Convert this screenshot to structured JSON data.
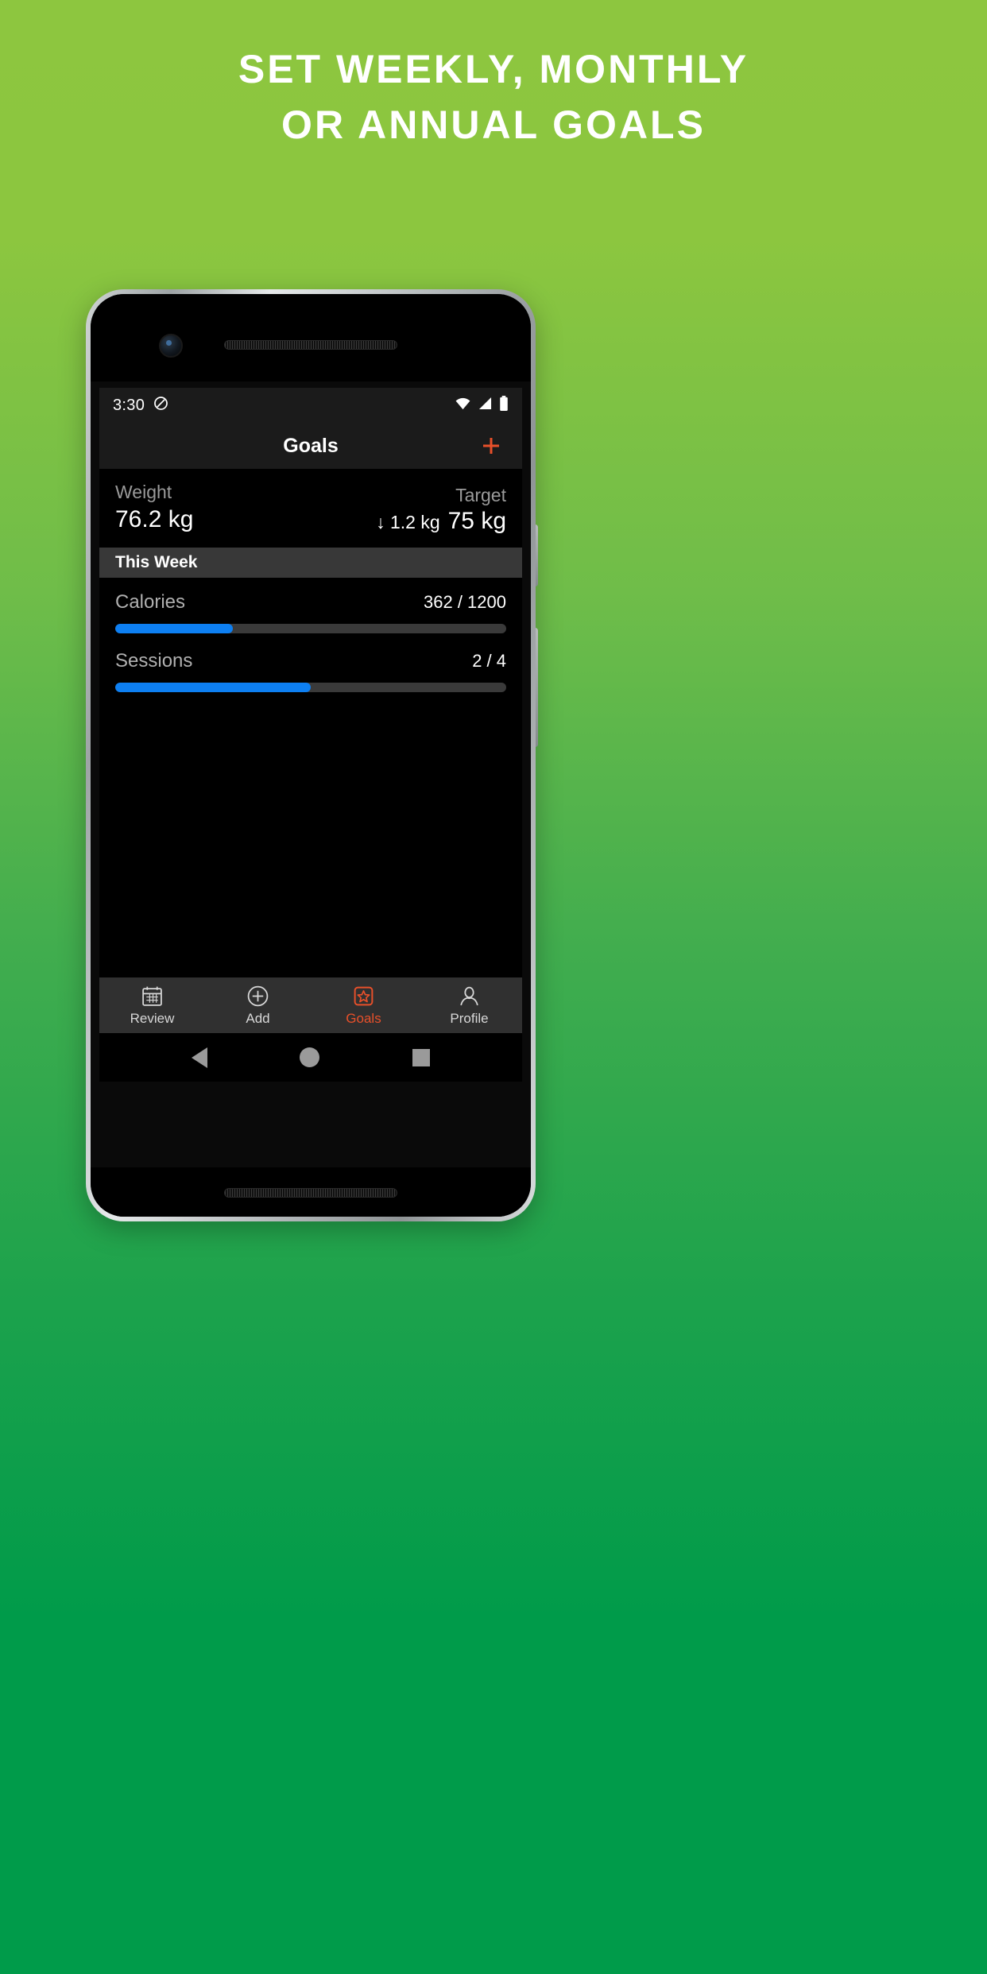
{
  "promo": {
    "headline_line1": "SET WEEKLY, MONTHLY",
    "headline_line2": "OR ANNUAL GOALS",
    "background_top_color": "#8dc63f",
    "background_bottom_color": "#009b4a",
    "headline_color": "#ffffff"
  },
  "status_bar": {
    "time": "3:30",
    "dnd_icon": "do-not-disturb-icon",
    "wifi_icon": "wifi-icon",
    "signal_icon": "cellular-signal-icon",
    "battery_icon": "battery-full-icon"
  },
  "app_bar": {
    "title": "Goals",
    "add_icon": "plus-icon",
    "accent_color": "#e8502a"
  },
  "weight": {
    "label": "Weight",
    "value": "76.2 kg",
    "target_label": "Target",
    "delta": "↓ 1.2 kg",
    "target_value": "75 kg"
  },
  "section": {
    "title": "This Week"
  },
  "goals": [
    {
      "name": "Calories",
      "value": "362 / 1200",
      "progress_percent": 30,
      "bar_color": "#0d7ff2",
      "track_color": "#3a3a3a"
    },
    {
      "name": "Sessions",
      "value": "2 / 4",
      "progress_percent": 50,
      "bar_color": "#0d7ff2",
      "track_color": "#3a3a3a"
    }
  ],
  "tab_bar": {
    "items": [
      {
        "label": "Review",
        "icon": "calendar-icon",
        "active": false
      },
      {
        "label": "Add",
        "icon": "plus-circle-icon",
        "active": false
      },
      {
        "label": "Goals",
        "icon": "star-badge-icon",
        "active": true
      },
      {
        "label": "Profile",
        "icon": "person-icon",
        "active": false
      }
    ],
    "active_color": "#e8502a",
    "inactive_color": "#d8d8d8"
  },
  "android_nav": {
    "back": "back-triangle-icon",
    "home": "home-circle-icon",
    "recents": "recents-square-icon"
  }
}
